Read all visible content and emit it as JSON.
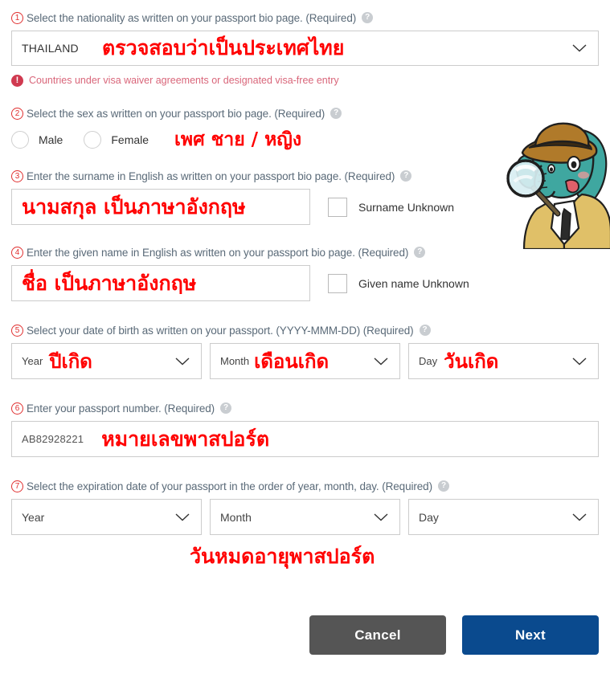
{
  "page": {
    "language_note": "Japanese Visit Japan Web style passport entry form with Thai red handwritten-style annotations"
  },
  "icons": {
    "help": "?",
    "warning": "!",
    "chevron_down": "chevron-down-icon"
  },
  "colors": {
    "annotation_red": "#ff0000",
    "question_text": "#5a6a78",
    "number_circle": "#e03030",
    "warning_red": "#d03a50",
    "warning_text": "#d9667a",
    "next_button": "#0a4a8e",
    "cancel_button": "#555555",
    "field_border": "#cccccc"
  },
  "questions": [
    {
      "number": "1",
      "text": "Select the nationality as written on your passport bio page. (Required)",
      "value": "THAILAND",
      "annotation": "ตรวจสอบว่าเป็นประเทศไทย",
      "warning": "Countries under visa waiver agreements or designated visa-free entry"
    },
    {
      "number": "2",
      "text": "Select the sex as written on your passport bio page. (Required)",
      "options": [
        "Male",
        "Female"
      ],
      "annotation": "เพศ ชาย / หญิง"
    },
    {
      "number": "3",
      "text": "Enter the surname in English as written on your passport bio page. (Required)",
      "annotation": "นามสกุล เป็นภาษาอังกฤษ",
      "checkbox_label": "Surname Unknown"
    },
    {
      "number": "4",
      "text": "Enter the given name in English as written on your passport bio page. (Required)",
      "annotation": "ชื่อ เป็นภาษาอังกฤษ",
      "checkbox_label": "Given name Unknown"
    },
    {
      "number": "5",
      "text": "Select your date of birth as written on your passport. (YYYY-MMM-DD) (Required)",
      "year_label": "Year",
      "month_label": "Month",
      "day_label": "Day",
      "year_annotation": "ปีเกิด",
      "month_annotation": "เดือนเกิด",
      "day_annotation": "วันเกิด"
    },
    {
      "number": "6",
      "text": "Enter your passport number. (Required)",
      "value": "AB82928221",
      "annotation": "หมายเลขพาสปอร์ต"
    },
    {
      "number": "7",
      "text": "Select the expiration date of your passport in the order of year, month, day. (Required)",
      "year_label": "Year",
      "month_label": "Month",
      "day_label": "Day",
      "annotation": "วันหมดอายุพาสปอร์ต"
    }
  ],
  "buttons": {
    "cancel": "Cancel",
    "next": "Next"
  }
}
